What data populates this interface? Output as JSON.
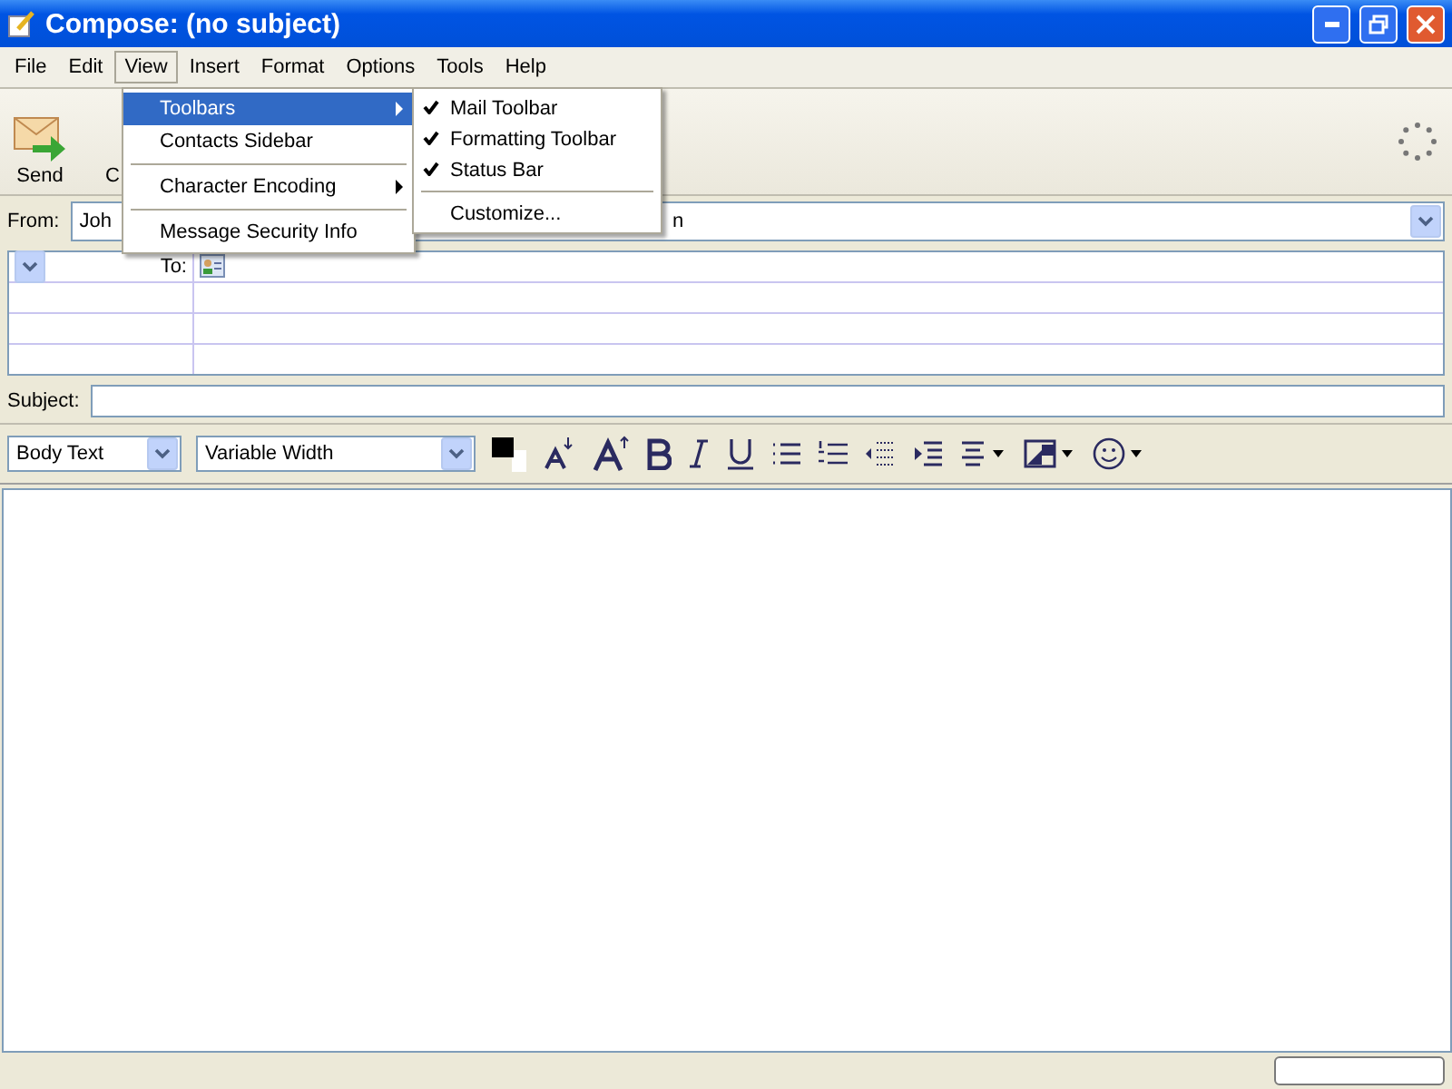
{
  "window": {
    "title": "Compose: (no subject)"
  },
  "menu_bar": [
    {
      "label": "File",
      "selected": false
    },
    {
      "label": "Edit",
      "selected": false
    },
    {
      "label": "View",
      "selected": true
    },
    {
      "label": "Insert",
      "selected": false
    },
    {
      "label": "Format",
      "selected": false
    },
    {
      "label": "Options",
      "selected": false
    },
    {
      "label": "Tools",
      "selected": false
    },
    {
      "label": "Help",
      "selected": false
    }
  ],
  "toolbar": [
    {
      "label": "Send"
    },
    {
      "label": "C"
    }
  ],
  "from": {
    "label": "From:",
    "value": "Joh",
    "value_tail": "n"
  },
  "address": {
    "type_label": "To:"
  },
  "subject": {
    "label": "Subject:"
  },
  "format_toolbar": {
    "paragraph": "Body Text",
    "font": "Variable Width"
  },
  "view_menu": [
    {
      "kind": "item",
      "label": "Toolbars",
      "submenu": true,
      "selected": true
    },
    {
      "kind": "item",
      "label": "Contacts Sidebar",
      "submenu": false,
      "selected": false
    },
    {
      "kind": "separator"
    },
    {
      "kind": "item",
      "label": "Character Encoding",
      "submenu": true,
      "selected": false
    },
    {
      "kind": "separator"
    },
    {
      "kind": "item",
      "label": "Message Security Info",
      "submenu": false,
      "selected": false
    }
  ],
  "toolbars_submenu": [
    {
      "kind": "item",
      "label": "Mail Toolbar",
      "checked": true
    },
    {
      "kind": "item",
      "label": "Formatting Toolbar",
      "checked": true
    },
    {
      "kind": "item",
      "label": "Status Bar",
      "checked": true
    },
    {
      "kind": "separator"
    },
    {
      "kind": "item",
      "label": "Customize...",
      "checked": false
    }
  ]
}
